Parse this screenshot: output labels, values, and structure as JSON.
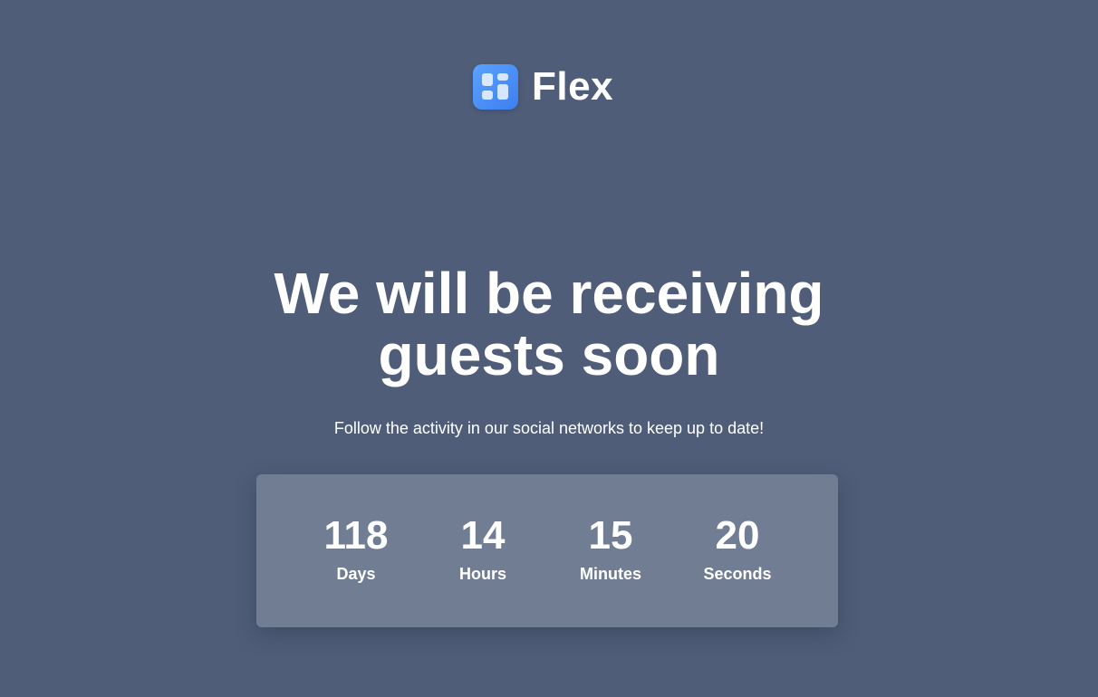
{
  "brand": {
    "name": "Flex",
    "logo_icon": "flex-logo-icon",
    "logo_color": "#4a8ff7"
  },
  "hero": {
    "headline_line1": "We will be receiving",
    "headline_line2": "guests soon",
    "subtitle": "Follow the activity in our social networks to keep up to date!"
  },
  "countdown": {
    "units": [
      {
        "value": "118",
        "label": "Days"
      },
      {
        "value": "14",
        "label": "Hours"
      },
      {
        "value": "15",
        "label": "Minutes"
      },
      {
        "value": "20",
        "label": "Seconds"
      }
    ]
  },
  "colors": {
    "background": "#4f5d79",
    "panel": "#707d93",
    "text": "#ffffff"
  }
}
